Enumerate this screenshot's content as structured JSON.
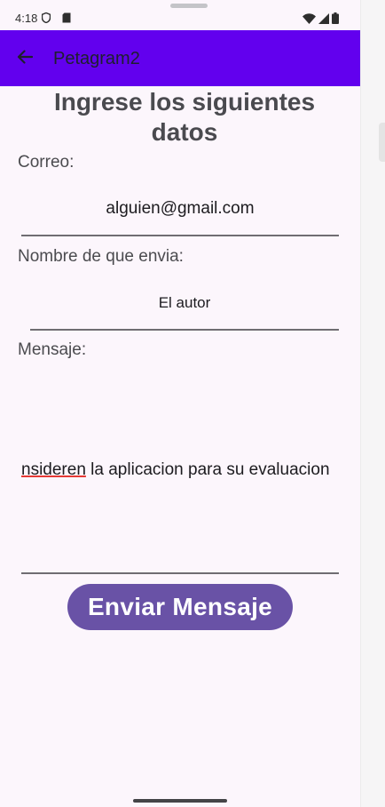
{
  "status_bar": {
    "time": "4:18",
    "left_icons": [
      "shield-icon",
      "sd-card-icon"
    ],
    "right_icons": [
      "wifi-icon",
      "signal-icon",
      "battery-icon"
    ]
  },
  "app_bar": {
    "title": "Petagram2",
    "back_icon": "arrow-back-icon",
    "color": "#6200ee"
  },
  "form": {
    "heading": "Ingrese los siguientes datos",
    "email_label": "Correo:",
    "email_value": "alguien@gmail.com",
    "name_label": "Nombre de que envia:",
    "name_value": "El autor",
    "message_label": "Mensaje:",
    "message_visible_start": "nsideren",
    "message_visible_rest": " la aplicacion para su evaluacion",
    "send_button": "Enviar Mensaje",
    "button_color": "#6952a6"
  }
}
